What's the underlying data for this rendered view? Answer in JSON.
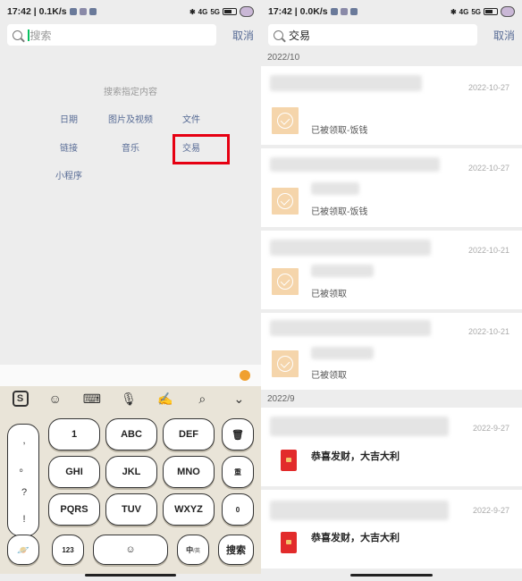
{
  "status_bar": {
    "time_left": "17:42",
    "speed_left": "0.1K/s",
    "time_right": "17:42",
    "speed_right": "0.0K/s",
    "signal_1": "4G",
    "signal_2": "5G"
  },
  "left_panel": {
    "search": {
      "placeholder": "搜索",
      "cancel_label": "取消"
    },
    "hint": "搜索指定内容",
    "options": [
      "日期",
      "图片及视频",
      "文件",
      "链接",
      "音乐",
      "交易",
      "小程序"
    ],
    "highlighted_option": "交易",
    "keyboard": {
      "symbols": [
        ",",
        "。",
        "?",
        "!"
      ],
      "row1": [
        "1",
        "ABC",
        "DEF"
      ],
      "row2": [
        "GHI",
        "JKL",
        "MNO"
      ],
      "row3": [
        "PQRS",
        "TUV",
        "WXYZ"
      ],
      "side_keys": [
        "重",
        "0"
      ],
      "bottom": {
        "num": "123",
        "lang": "中",
        "lang_sub": "/英",
        "search": "搜索"
      }
    }
  },
  "right_panel": {
    "search": {
      "query": "交易",
      "cancel_label": "取消"
    },
    "sections": [
      {
        "month": "2022/10",
        "items": [
          {
            "date": "2022-10-27",
            "status": "已被领取-饭钱"
          },
          {
            "date": "2022-10-27",
            "status": "已被领取-饭钱"
          },
          {
            "date": "2022-10-21",
            "status": "已被领取"
          },
          {
            "date": "2022-10-21",
            "status": "已被领取"
          }
        ]
      },
      {
        "month": "2022/9",
        "items": [
          {
            "date": "2022-9-27",
            "greeting": "恭喜发财，大吉大利"
          },
          {
            "date": "2022-9-27",
            "greeting": "恭喜发财，大吉大利"
          }
        ]
      }
    ]
  },
  "colors": {
    "link": "#576b95",
    "highlight_border": "#e60012",
    "transfer_icon_bg": "#f5d5ab",
    "red_packet": "#e22b2b",
    "cursor": "#07c160"
  }
}
